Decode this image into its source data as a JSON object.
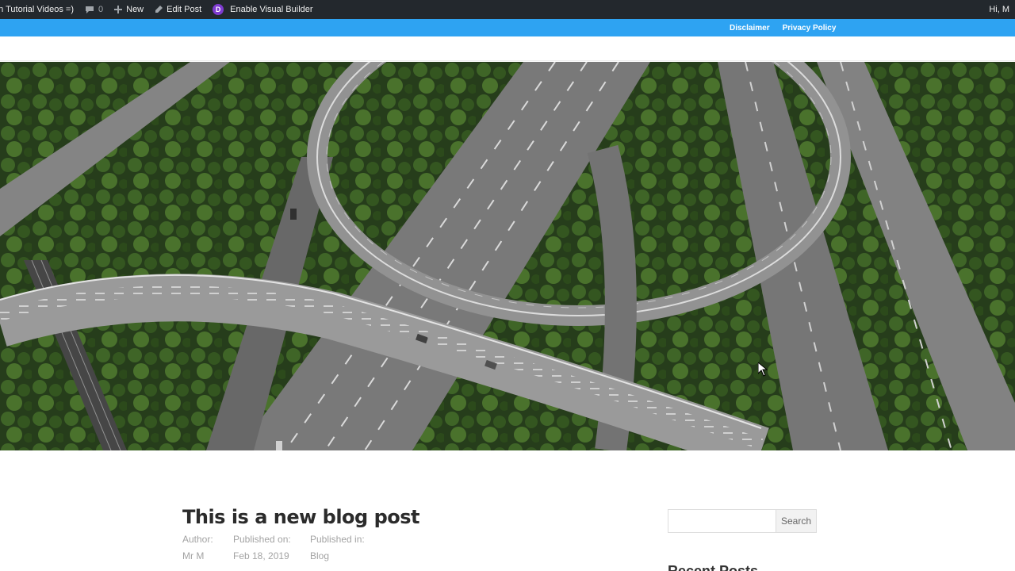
{
  "admin_bar": {
    "site_title": "en Tutorial Videos =)",
    "comments_count": "0",
    "new_label": "New",
    "edit_label": "Edit Post",
    "visual_builder_label": "Enable Visual Builder",
    "divi_letter": "D",
    "greeting": "Hi, M"
  },
  "top_nav": {
    "items": [
      {
        "label": "Disclaimer"
      },
      {
        "label": "Privacy Policy"
      }
    ]
  },
  "post": {
    "title": "This is a new blog post",
    "meta": {
      "author_label": "Author:",
      "author_value": "Mr M",
      "published_on_label": "Published on:",
      "published_on_value": "Feb 18, 2019",
      "published_in_label": "Published in:",
      "published_in_value": "Blog"
    }
  },
  "sidebar": {
    "search_value": "",
    "search_button": "Search",
    "widget_title": "Recent Posts"
  },
  "colors": {
    "admin_bar_bg": "#23282d",
    "nav_bg": "#2ea3f2",
    "divi_purple": "#7e3bd0",
    "title_text": "#2b2b2b",
    "meta_text": "#a3a3a3"
  },
  "hero_image": {
    "description_icon": "highway-interchange-aerial-photo"
  }
}
